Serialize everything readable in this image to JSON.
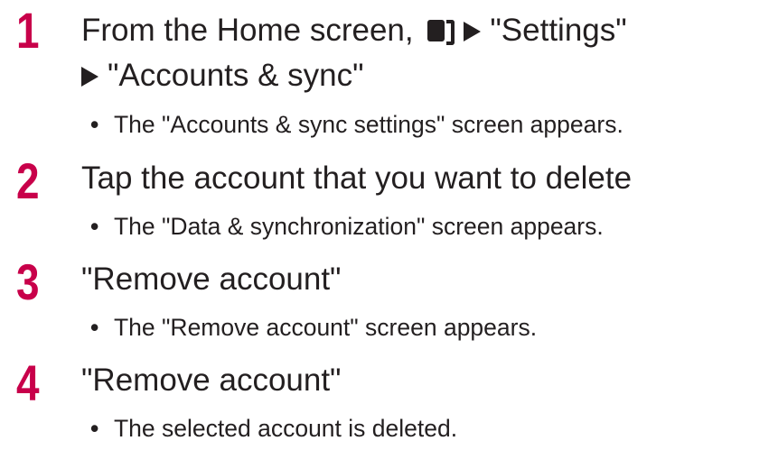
{
  "steps": [
    {
      "number": "1",
      "line1_prefix": "From the Home screen,",
      "line1_suffix": "\"Settings\"",
      "line2": "\"Accounts & sync\"",
      "note": "The \"Accounts & sync settings\" screen appears."
    },
    {
      "number": "2",
      "line1": "Tap the account that you want to delete",
      "note": "The \"Data & synchronization\" screen appears."
    },
    {
      "number": "3",
      "line1": "\"Remove account\"",
      "note": "The \"Remove account\" screen appears."
    },
    {
      "number": "4",
      "line1": "\"Remove account\"",
      "note": "The selected account is deleted."
    }
  ],
  "bullet_char": "•",
  "icons": {
    "menu_key": "menu-key-icon",
    "arrow": "triangle-right-icon"
  },
  "colors": {
    "step_number": "#c8004a",
    "text": "#231f20"
  }
}
